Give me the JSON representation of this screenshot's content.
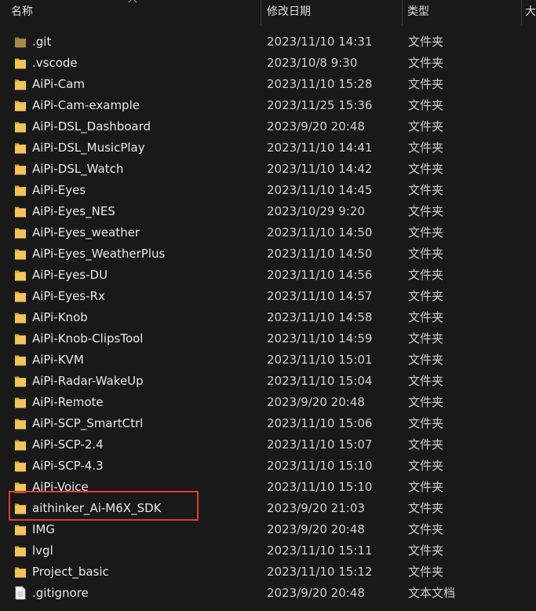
{
  "columns": {
    "name": "名称",
    "date": "修改日期",
    "type": "类型",
    "size": "大"
  },
  "colors": {
    "background": "#191919",
    "folder": "#f2c55c",
    "highlight": "#e53935"
  },
  "files": [
    {
      "name": ".git",
      "date": "2023/11/10 14:31",
      "type": "文件夹",
      "icon": "folder-icon"
    },
    {
      "name": ".vscode",
      "date": "2023/10/8 9:30",
      "type": "文件夹",
      "icon": "folder-icon"
    },
    {
      "name": "AiPi-Cam",
      "date": "2023/11/10 15:28",
      "type": "文件夹",
      "icon": "folder-icon"
    },
    {
      "name": "AiPi-Cam-example",
      "date": "2023/11/25 15:36",
      "type": "文件夹",
      "icon": "folder-icon"
    },
    {
      "name": "AiPi-DSL_Dashboard",
      "date": "2023/9/20 20:48",
      "type": "文件夹",
      "icon": "folder-icon"
    },
    {
      "name": "AiPi-DSL_MusicPlay",
      "date": "2023/11/10 14:41",
      "type": "文件夹",
      "icon": "folder-icon"
    },
    {
      "name": "AiPi-DSL_Watch",
      "date": "2023/11/10 14:42",
      "type": "文件夹",
      "icon": "folder-icon"
    },
    {
      "name": "AiPi-Eyes",
      "date": "2023/11/10 14:45",
      "type": "文件夹",
      "icon": "folder-icon"
    },
    {
      "name": "AiPi-Eyes_NES",
      "date": "2023/10/29 9:20",
      "type": "文件夹",
      "icon": "folder-icon"
    },
    {
      "name": "AiPi-Eyes_weather",
      "date": "2023/11/10 14:50",
      "type": "文件夹",
      "icon": "folder-icon"
    },
    {
      "name": "AiPi-Eyes_WeatherPlus",
      "date": "2023/11/10 14:50",
      "type": "文件夹",
      "icon": "folder-icon"
    },
    {
      "name": "AiPi-Eyes-DU",
      "date": "2023/11/10 14:56",
      "type": "文件夹",
      "icon": "folder-icon"
    },
    {
      "name": "AiPi-Eyes-Rx",
      "date": "2023/11/10 14:57",
      "type": "文件夹",
      "icon": "folder-icon"
    },
    {
      "name": "AiPi-Knob",
      "date": "2023/11/10 14:58",
      "type": "文件夹",
      "icon": "folder-icon"
    },
    {
      "name": "AiPi-Knob-ClipsTool",
      "date": "2023/11/10 14:59",
      "type": "文件夹",
      "icon": "folder-icon"
    },
    {
      "name": "AiPi-KVM",
      "date": "2023/11/10 15:01",
      "type": "文件夹",
      "icon": "folder-icon"
    },
    {
      "name": "AiPi-Radar-WakeUp",
      "date": "2023/11/10 15:04",
      "type": "文件夹",
      "icon": "folder-icon"
    },
    {
      "name": "AiPi-Remote",
      "date": "2023/9/20 20:48",
      "type": "文件夹",
      "icon": "folder-icon"
    },
    {
      "name": "AiPi-SCP_SmartCtrl",
      "date": "2023/11/10 15:06",
      "type": "文件夹",
      "icon": "folder-icon"
    },
    {
      "name": "AiPi-SCP-2.4",
      "date": "2023/11/10 15:07",
      "type": "文件夹",
      "icon": "folder-icon"
    },
    {
      "name": "AiPi-SCP-4.3",
      "date": "2023/11/10 15:10",
      "type": "文件夹",
      "icon": "folder-icon"
    },
    {
      "name": "AiPi-Voice",
      "date": "2023/11/10 15:10",
      "type": "文件夹",
      "icon": "folder-icon"
    },
    {
      "name": "aithinker_Ai-M6X_SDK",
      "date": "2023/9/20 21:03",
      "type": "文件夹",
      "icon": "folder-icon",
      "highlighted": true
    },
    {
      "name": "IMG",
      "date": "2023/9/20 20:48",
      "type": "文件夹",
      "icon": "folder-icon"
    },
    {
      "name": "lvgl",
      "date": "2023/11/10 15:11",
      "type": "文件夹",
      "icon": "folder-icon"
    },
    {
      "name": "Project_basic",
      "date": "2023/11/10 15:12",
      "type": "文件夹",
      "icon": "folder-icon"
    },
    {
      "name": ".gitignore",
      "date": "2023/9/20 20:48",
      "type": "文本文档",
      "icon": "text-file-icon"
    }
  ]
}
